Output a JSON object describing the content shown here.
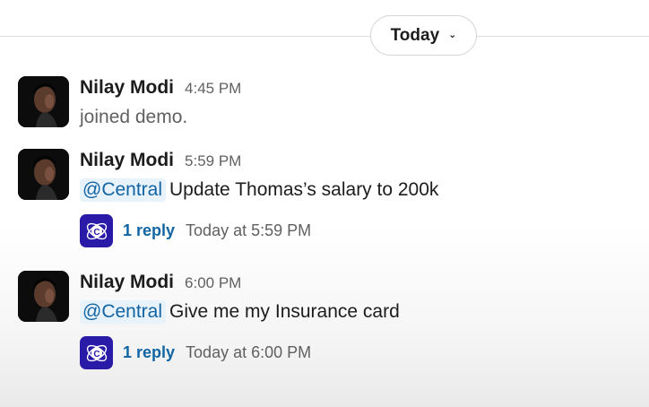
{
  "date_divider": {
    "label": "Today",
    "chevron_icon": "chevron-down-icon"
  },
  "messages": [
    {
      "author": "Nilay Modi",
      "time": "4:45 PM",
      "type": "system",
      "text": "joined demo."
    },
    {
      "author": "Nilay Modi",
      "time": "5:59 PM",
      "type": "message",
      "mention": "@Central",
      "text": "Update Thomas’s salary to 200k",
      "thread": {
        "reply_count": "1 reply",
        "last_reply": "Today at 5:59 PM",
        "replier_icon": "central-app-icon"
      }
    },
    {
      "author": "Nilay Modi",
      "time": "6:00 PM",
      "type": "message",
      "mention": "@Central",
      "text": "Give me my Insurance card",
      "thread": {
        "reply_count": "1 reply",
        "last_reply": "Today at 6:00 PM",
        "replier_icon": "central-app-icon"
      }
    }
  ],
  "colors": {
    "mention_text": "#1264a3",
    "mention_bg": "#e8f2fa",
    "app_icon_bg": "#2a1aa8",
    "muted_text": "#616061"
  }
}
